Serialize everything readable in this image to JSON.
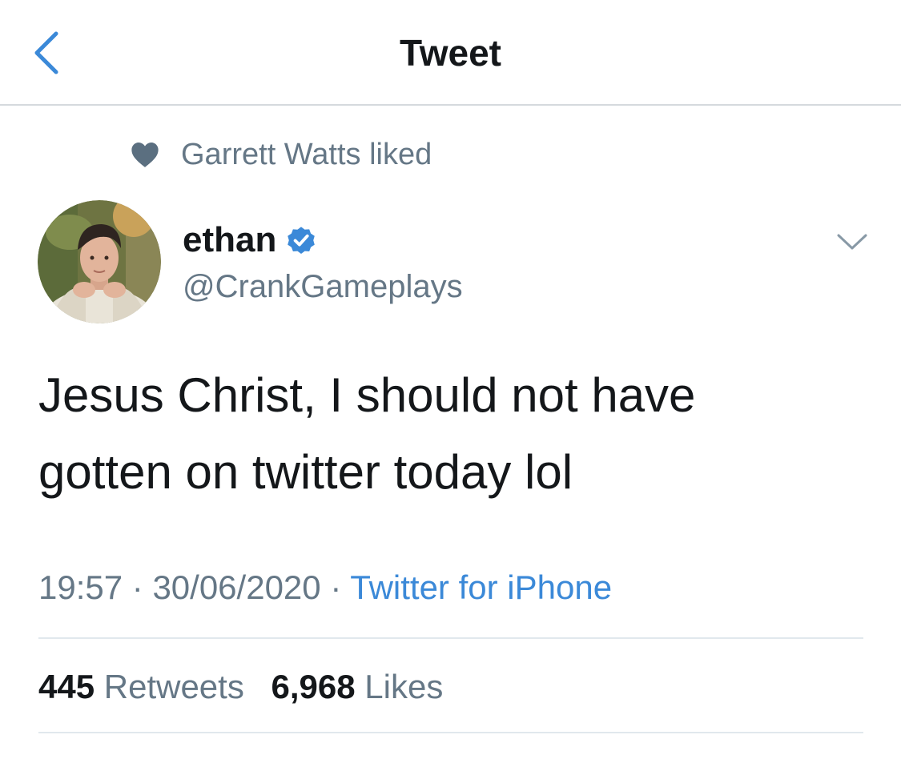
{
  "nav": {
    "title": "Tweet",
    "back_icon": "chevron-left-icon"
  },
  "social_context": {
    "icon": "heart-icon",
    "text": "Garrett Watts liked"
  },
  "author": {
    "name": "ethan",
    "verified": true,
    "handle": "@CrankGameplays"
  },
  "tweet": {
    "text_line1": "Jesus Christ, I should not have",
    "text_line2": "gotten on twitter today lol"
  },
  "meta": {
    "time": "19:57",
    "separator": " · ",
    "date": "30/06/2020",
    "source": "Twitter for iPhone"
  },
  "stats": {
    "retweets_count": "445",
    "retweets_label": "Retweets",
    "likes_count": "6,968",
    "likes_label": "Likes"
  },
  "colors": {
    "accent": "#3b89d8",
    "secondary_text": "#657786",
    "primary_text": "#14171a",
    "verified_badge": "#3b89d8"
  }
}
